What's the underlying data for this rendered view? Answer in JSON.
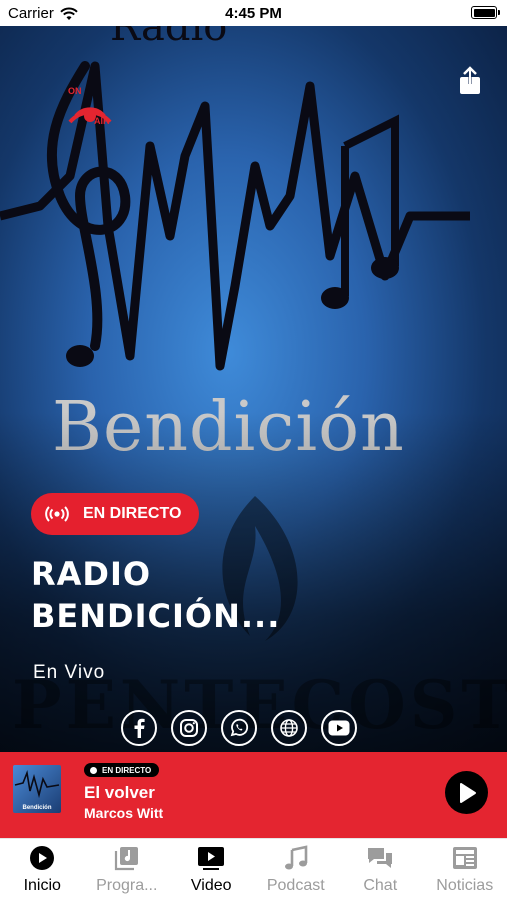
{
  "status_bar": {
    "carrier": "Carrier",
    "time": "4:45 PM"
  },
  "hero": {
    "onair_top": "ON",
    "onair_bottom": "AIR",
    "artwork_word": "Bendición",
    "live_badge": "EN DIRECTO",
    "station_title": "RADIO BENDICIÓN...",
    "subtitle": "En Vivo",
    "socials": [
      "facebook-icon",
      "instagram-icon",
      "whatsapp-icon",
      "globe-icon",
      "youtube-icon"
    ]
  },
  "player": {
    "badge": "EN DIRECTO",
    "song": "El volver",
    "artist": "Marcos Witt",
    "accent_color": "#e42530"
  },
  "tabs": [
    {
      "label": "Inicio",
      "icon": "play-circle-icon",
      "active": true
    },
    {
      "label": "Progra...",
      "icon": "music-library-icon",
      "active": false
    },
    {
      "label": "Video",
      "icon": "video-play-icon",
      "active": true
    },
    {
      "label": "Podcast",
      "icon": "music-note-icon",
      "active": false
    },
    {
      "label": "Chat",
      "icon": "chat-bubbles-icon",
      "active": false
    },
    {
      "label": "Noticias",
      "icon": "newspaper-icon",
      "active": false
    }
  ]
}
